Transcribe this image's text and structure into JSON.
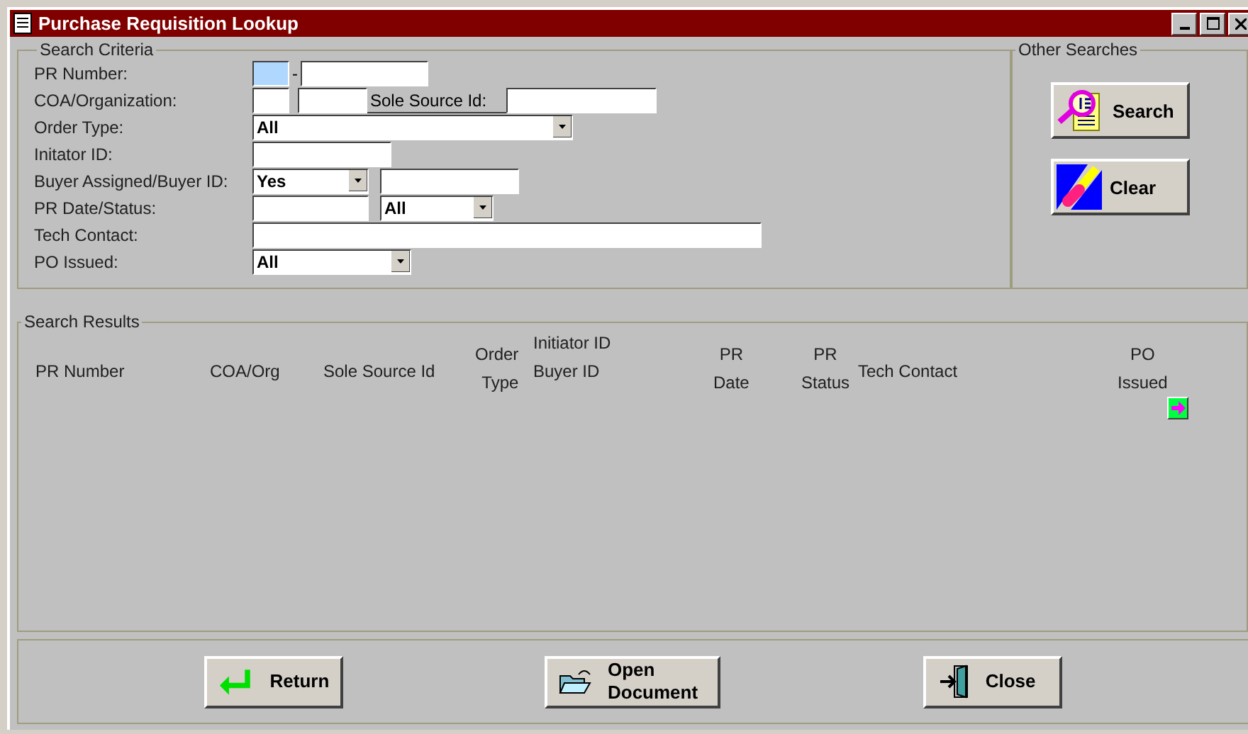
{
  "window": {
    "title": "Purchase Requisition Lookup"
  },
  "search_criteria": {
    "title": "Search Criteria",
    "rows": [
      {
        "label": "PR Number:",
        "controls": [
          {
            "kind": "text",
            "focused": true
          },
          {
            "kind": "dash",
            "text": "-"
          },
          {
            "kind": "text",
            "focused": false
          }
        ]
      },
      {
        "label": "COA/Organization:",
        "controls": [
          {
            "kind": "text",
            "focused": false
          },
          {
            "kind": "text",
            "focused": false
          },
          {
            "kind": "label",
            "text": "Sole Source Id:"
          },
          {
            "kind": "text",
            "focused": false
          }
        ]
      },
      {
        "label": "Order Type:",
        "controls": [
          {
            "kind": "select",
            "value": "All"
          }
        ]
      },
      {
        "label": "Initator ID:",
        "controls": [
          {
            "kind": "text",
            "focused": false
          }
        ]
      },
      {
        "label": "Buyer Assigned/Buyer ID:",
        "controls": [
          {
            "kind": "select",
            "value": "Yes"
          },
          {
            "kind": "text",
            "focused": false
          }
        ]
      },
      {
        "label": "PR Date/Status:",
        "controls": [
          {
            "kind": "text",
            "focused": false
          },
          {
            "kind": "select",
            "value": "All"
          }
        ]
      },
      {
        "label": "Tech Contact:",
        "controls": [
          {
            "kind": "text",
            "focused": false
          }
        ]
      },
      {
        "label": "PO Issued:",
        "controls": [
          {
            "kind": "select",
            "value": "All"
          }
        ]
      }
    ]
  },
  "other_searches": {
    "title": "Other Searches",
    "buttons": [
      {
        "label": "Search",
        "kind": "search"
      },
      {
        "label": "Clear",
        "kind": "clear"
      }
    ]
  },
  "search_results": {
    "title": "Search Results",
    "columns": [
      [
        "PR Number"
      ],
      [
        "COA/Org"
      ],
      [
        "Sole Source Id"
      ],
      [
        "Order",
        "Type"
      ],
      [
        "Initiator ID",
        "Buyer ID"
      ],
      [
        "PR",
        "Date"
      ],
      [
        "PR",
        "Status"
      ],
      [
        "Tech Contact"
      ],
      [
        "PO",
        "Issued"
      ]
    ]
  },
  "buttons": [
    {
      "label": "Return",
      "kind": "return"
    },
    {
      "label": "Open\nDocument",
      "kind": "open"
    },
    {
      "label": "Close",
      "kind": "close"
    }
  ]
}
